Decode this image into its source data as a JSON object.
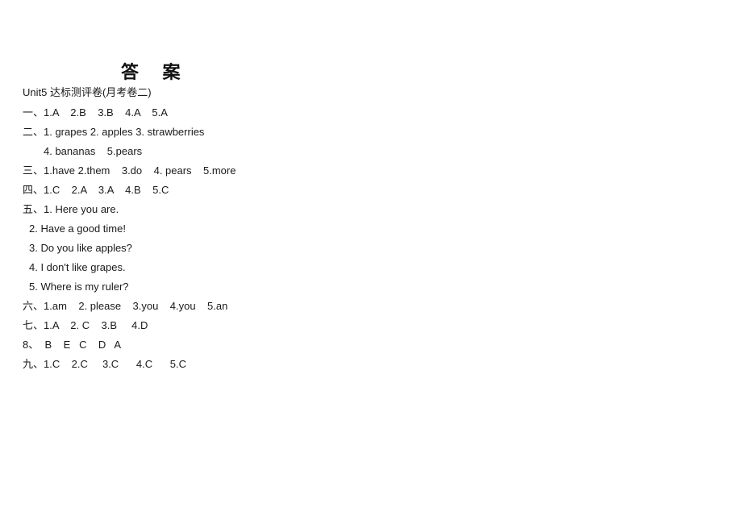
{
  "document": {
    "title": "答    案",
    "subtitle": "Unit5 达标测评卷(月考卷二)",
    "lines": [
      {
        "text": "一、1.A    2.B    3.B    4.A    5.A",
        "indent": "none"
      },
      {
        "text": "二、1. grapes 2. apples 3. strawberries",
        "indent": "none"
      },
      {
        "text": "4. bananas    5.pears",
        "indent": "indent-1"
      },
      {
        "text": "三、1.have 2.them    3.do    4. pears    5.more",
        "indent": "none"
      },
      {
        "text": "四、1.C    2.A    3.A    4.B    5.C",
        "indent": "none"
      },
      {
        "text": "五、1. Here you are.",
        "indent": "none"
      },
      {
        "text": "2. Have a good time!",
        "indent": "indent-2"
      },
      {
        "text": "3. Do you like apples?",
        "indent": "indent-2"
      },
      {
        "text": "4. I don't like grapes.",
        "indent": "indent-2"
      },
      {
        "text": "5. Where is my ruler?",
        "indent": "indent-2"
      },
      {
        "text": "六、1.am    2. please    3.you    4.you    5.an",
        "indent": "none"
      },
      {
        "text": "七、1.A    2. C    3.B     4.D",
        "indent": "none"
      },
      {
        "text": "8、  B    E   C    D   A",
        "indent": "none"
      },
      {
        "text": "九、1.C    2.C     3.C      4.C      5.C",
        "indent": "none"
      }
    ]
  },
  "colors": {
    "page_background": "#ffffff",
    "text": "#1a1a1a"
  }
}
